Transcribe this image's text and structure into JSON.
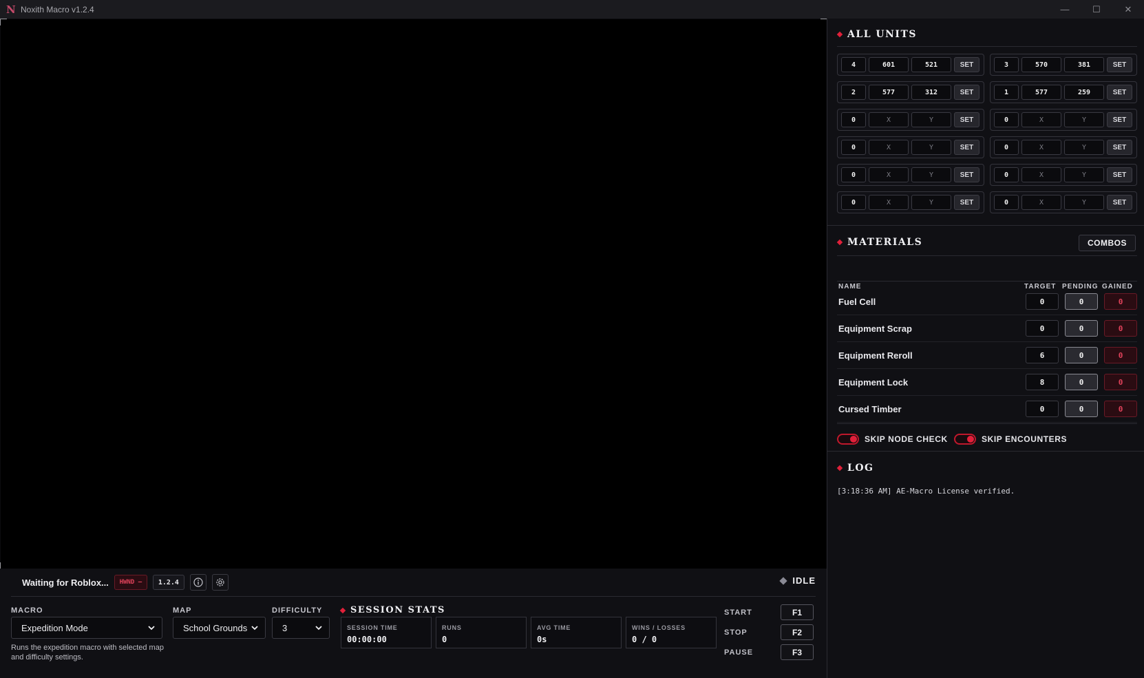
{
  "window": {
    "title": "Noxith Macro v1.2.4",
    "logo": "N",
    "minimize_icon": "—",
    "maximize_icon": "☐",
    "close_icon": "✕"
  },
  "status": {
    "waiting": "Waiting for Roblox...",
    "hwnd": "HWND —",
    "version": "1.2.4",
    "state": "IDLE"
  },
  "units": {
    "title": "ALL UNITS",
    "set_label": "SET",
    "rows": [
      {
        "slot": "4",
        "x": "601",
        "y": "521"
      },
      {
        "slot": "3",
        "x": "570",
        "y": "381"
      },
      {
        "slot": "2",
        "x": "577",
        "y": "312"
      },
      {
        "slot": "1",
        "x": "577",
        "y": "259"
      },
      {
        "slot": "0",
        "x": "X",
        "y": "Y"
      },
      {
        "slot": "0",
        "x": "X",
        "y": "Y"
      },
      {
        "slot": "0",
        "x": "X",
        "y": "Y"
      },
      {
        "slot": "0",
        "x": "X",
        "y": "Y"
      },
      {
        "slot": "0",
        "x": "X",
        "y": "Y"
      },
      {
        "slot": "0",
        "x": "X",
        "y": "Y"
      },
      {
        "slot": "0",
        "x": "X",
        "y": "Y"
      },
      {
        "slot": "0",
        "x": "X",
        "y": "Y"
      }
    ]
  },
  "materials": {
    "title": "MATERIALS",
    "combos_label": "COMBOS",
    "headers": {
      "name": "NAME",
      "target": "TARGET",
      "pending": "PENDING",
      "gained": "GAINED"
    },
    "rows": [
      {
        "name": "Fuel Cell",
        "target": "0",
        "pending": "0",
        "gained": "0"
      },
      {
        "name": "Equipment Scrap",
        "target": "0",
        "pending": "0",
        "gained": "0"
      },
      {
        "name": "Equipment Reroll",
        "target": "6",
        "pending": "0",
        "gained": "0"
      },
      {
        "name": "Equipment Lock",
        "target": "8",
        "pending": "0",
        "gained": "0"
      },
      {
        "name": "Cursed Timber",
        "target": "0",
        "pending": "0",
        "gained": "0"
      }
    ]
  },
  "toggles": [
    {
      "label": "SKIP NODE CHECK",
      "on": true
    },
    {
      "label": "SKIP ENCOUNTERS",
      "on": true
    }
  ],
  "log": {
    "title": "LOG",
    "lines": [
      "[3:18:36 AM] AE-Macro License verified."
    ]
  },
  "controls": {
    "macro_label": "MACRO",
    "macro_value": "Expedition Mode",
    "map_label": "MAP",
    "map_value": "School Grounds",
    "difficulty_label": "DIFFICULTY",
    "difficulty_value": "3",
    "description": "Runs the expedition macro with selected map and difficulty settings."
  },
  "session": {
    "title": "SESSION STATS",
    "stats": [
      {
        "label": "SESSION TIME",
        "value": "00:00:00"
      },
      {
        "label": "RUNS",
        "value": "0"
      },
      {
        "label": "AVG TIME",
        "value": "0s"
      },
      {
        "label": "WINS / LOSSES",
        "value": "0 / 0"
      }
    ]
  },
  "hotkeys": [
    {
      "label": "START",
      "key": "F1"
    },
    {
      "label": "STOP",
      "key": "F2"
    },
    {
      "label": "PAUSE",
      "key": "F3"
    }
  ],
  "colors": {
    "accent": "#e0203a",
    "background": "#101014",
    "viewport": "#000000"
  }
}
